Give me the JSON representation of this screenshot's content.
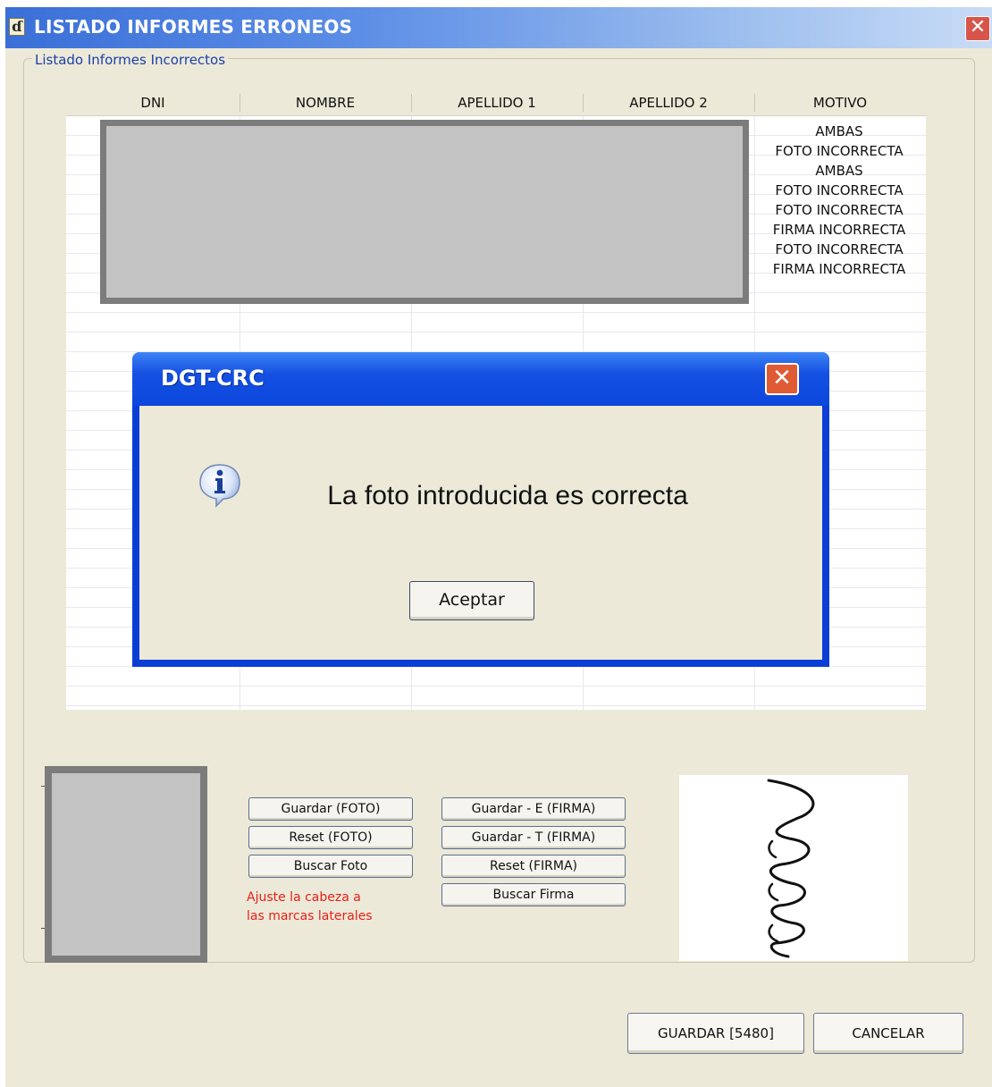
{
  "window": {
    "title": "LISTADO INFORMES ERRONEOS",
    "close_label": "✕"
  },
  "group": {
    "label": "Listado Informes Incorrectos"
  },
  "table": {
    "columns": [
      "DNI",
      "NOMBRE",
      "APELLIDO 1",
      "APELLIDO 2",
      "MOTIVO"
    ],
    "motivos": [
      "AMBAS",
      "FOTO INCORRECTA",
      "AMBAS",
      "FOTO INCORRECTA",
      "FOTO INCORRECTA",
      "FIRMA INCORRECTA",
      "FOTO INCORRECTA",
      "FIRMA INCORRECTA"
    ]
  },
  "photo_controls": {
    "save": "Guardar (FOTO)",
    "reset": "Reset (FOTO)",
    "search": "Buscar Foto",
    "hint_line1": "Ajuste la cabeza a",
    "hint_line2": "las marcas laterales"
  },
  "signature_controls": {
    "save_e": "Guardar - E (FIRMA)",
    "save_t": "Guardar - T (FIRMA)",
    "reset": "Reset (FIRMA)",
    "search": "Buscar Firma"
  },
  "footer": {
    "save": "GUARDAR [5480]",
    "cancel": "CANCELAR"
  },
  "dialog": {
    "title": "DGT-CRC",
    "message": "La foto introducida es correcta",
    "ok": "Aceptar",
    "icon": "info-icon"
  },
  "colors": {
    "titlebar": "#3a6fd8",
    "dialog_frame": "#0a3ed6",
    "hint_text": "#e8201a",
    "window_bg": "#ece9d8"
  }
}
